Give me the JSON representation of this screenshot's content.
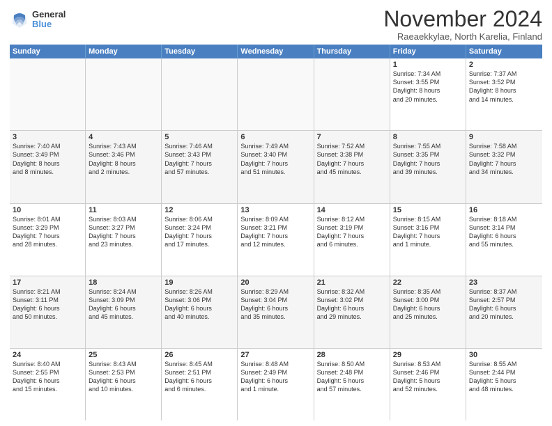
{
  "header": {
    "logo_line1": "General",
    "logo_line2": "Blue",
    "month": "November 2024",
    "location": "Raeaekkylae, North Karelia, Finland"
  },
  "days_of_week": [
    "Sunday",
    "Monday",
    "Tuesday",
    "Wednesday",
    "Thursday",
    "Friday",
    "Saturday"
  ],
  "weeks": [
    [
      {
        "day": "",
        "info": ""
      },
      {
        "day": "",
        "info": ""
      },
      {
        "day": "",
        "info": ""
      },
      {
        "day": "",
        "info": ""
      },
      {
        "day": "",
        "info": ""
      },
      {
        "day": "1",
        "info": "Sunrise: 7:34 AM\nSunset: 3:55 PM\nDaylight: 8 hours\nand 20 minutes."
      },
      {
        "day": "2",
        "info": "Sunrise: 7:37 AM\nSunset: 3:52 PM\nDaylight: 8 hours\nand 14 minutes."
      }
    ],
    [
      {
        "day": "3",
        "info": "Sunrise: 7:40 AM\nSunset: 3:49 PM\nDaylight: 8 hours\nand 8 minutes."
      },
      {
        "day": "4",
        "info": "Sunrise: 7:43 AM\nSunset: 3:46 PM\nDaylight: 8 hours\nand 2 minutes."
      },
      {
        "day": "5",
        "info": "Sunrise: 7:46 AM\nSunset: 3:43 PM\nDaylight: 7 hours\nand 57 minutes."
      },
      {
        "day": "6",
        "info": "Sunrise: 7:49 AM\nSunset: 3:40 PM\nDaylight: 7 hours\nand 51 minutes."
      },
      {
        "day": "7",
        "info": "Sunrise: 7:52 AM\nSunset: 3:38 PM\nDaylight: 7 hours\nand 45 minutes."
      },
      {
        "day": "8",
        "info": "Sunrise: 7:55 AM\nSunset: 3:35 PM\nDaylight: 7 hours\nand 39 minutes."
      },
      {
        "day": "9",
        "info": "Sunrise: 7:58 AM\nSunset: 3:32 PM\nDaylight: 7 hours\nand 34 minutes."
      }
    ],
    [
      {
        "day": "10",
        "info": "Sunrise: 8:01 AM\nSunset: 3:29 PM\nDaylight: 7 hours\nand 28 minutes."
      },
      {
        "day": "11",
        "info": "Sunrise: 8:03 AM\nSunset: 3:27 PM\nDaylight: 7 hours\nand 23 minutes."
      },
      {
        "day": "12",
        "info": "Sunrise: 8:06 AM\nSunset: 3:24 PM\nDaylight: 7 hours\nand 17 minutes."
      },
      {
        "day": "13",
        "info": "Sunrise: 8:09 AM\nSunset: 3:21 PM\nDaylight: 7 hours\nand 12 minutes."
      },
      {
        "day": "14",
        "info": "Sunrise: 8:12 AM\nSunset: 3:19 PM\nDaylight: 7 hours\nand 6 minutes."
      },
      {
        "day": "15",
        "info": "Sunrise: 8:15 AM\nSunset: 3:16 PM\nDaylight: 7 hours\nand 1 minute."
      },
      {
        "day": "16",
        "info": "Sunrise: 8:18 AM\nSunset: 3:14 PM\nDaylight: 6 hours\nand 55 minutes."
      }
    ],
    [
      {
        "day": "17",
        "info": "Sunrise: 8:21 AM\nSunset: 3:11 PM\nDaylight: 6 hours\nand 50 minutes."
      },
      {
        "day": "18",
        "info": "Sunrise: 8:24 AM\nSunset: 3:09 PM\nDaylight: 6 hours\nand 45 minutes."
      },
      {
        "day": "19",
        "info": "Sunrise: 8:26 AM\nSunset: 3:06 PM\nDaylight: 6 hours\nand 40 minutes."
      },
      {
        "day": "20",
        "info": "Sunrise: 8:29 AM\nSunset: 3:04 PM\nDaylight: 6 hours\nand 35 minutes."
      },
      {
        "day": "21",
        "info": "Sunrise: 8:32 AM\nSunset: 3:02 PM\nDaylight: 6 hours\nand 29 minutes."
      },
      {
        "day": "22",
        "info": "Sunrise: 8:35 AM\nSunset: 3:00 PM\nDaylight: 6 hours\nand 25 minutes."
      },
      {
        "day": "23",
        "info": "Sunrise: 8:37 AM\nSunset: 2:57 PM\nDaylight: 6 hours\nand 20 minutes."
      }
    ],
    [
      {
        "day": "24",
        "info": "Sunrise: 8:40 AM\nSunset: 2:55 PM\nDaylight: 6 hours\nand 15 minutes."
      },
      {
        "day": "25",
        "info": "Sunrise: 8:43 AM\nSunset: 2:53 PM\nDaylight: 6 hours\nand 10 minutes."
      },
      {
        "day": "26",
        "info": "Sunrise: 8:45 AM\nSunset: 2:51 PM\nDaylight: 6 hours\nand 6 minutes."
      },
      {
        "day": "27",
        "info": "Sunrise: 8:48 AM\nSunset: 2:49 PM\nDaylight: 6 hours\nand 1 minute."
      },
      {
        "day": "28",
        "info": "Sunrise: 8:50 AM\nSunset: 2:48 PM\nDaylight: 5 hours\nand 57 minutes."
      },
      {
        "day": "29",
        "info": "Sunrise: 8:53 AM\nSunset: 2:46 PM\nDaylight: 5 hours\nand 52 minutes."
      },
      {
        "day": "30",
        "info": "Sunrise: 8:55 AM\nSunset: 2:44 PM\nDaylight: 5 hours\nand 48 minutes."
      }
    ]
  ]
}
